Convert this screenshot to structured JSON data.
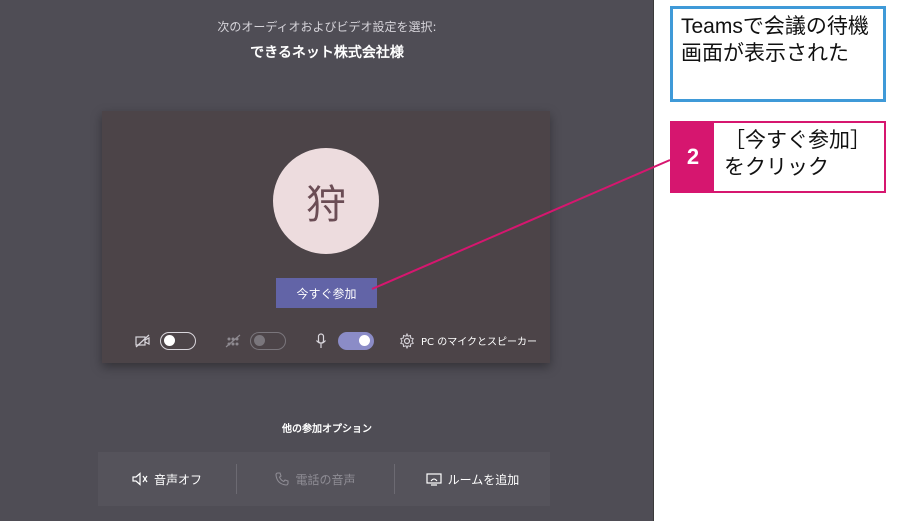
{
  "header": {
    "subtitle": "次のオーディオおよびビデオ設定を選択:",
    "meeting_name": "できるネット株式会社様"
  },
  "preview": {
    "avatar_initial": "狩",
    "join_label": "今すぐ参加",
    "controls": {
      "camera": {
        "icon": "camera-off-icon",
        "state": "off"
      },
      "background_blur": {
        "icon": "background-blur-icon",
        "state": "disabled"
      },
      "microphone": {
        "icon": "microphone-icon",
        "state": "on"
      },
      "device_settings_label": "PC のマイクとスピーカー",
      "device_settings_icon": "gear-icon"
    }
  },
  "other_options": {
    "heading": "他の参加オプション",
    "items": [
      {
        "label": "音声オフ",
        "icon": "speaker-off-icon",
        "enabled": true
      },
      {
        "label": "電話の音声",
        "icon": "phone-icon",
        "enabled": false
      },
      {
        "label": "ルームを追加",
        "icon": "room-icon",
        "enabled": true
      }
    ]
  },
  "annotations": {
    "caption": "Teamsで会議の待機画面が表示された",
    "step_number": "2",
    "step_text": "［今すぐ参加］をクリック"
  },
  "colors": {
    "window_bg": "#4f4d55",
    "card_bg": "#4c4448",
    "accent": "#6264a7",
    "avatar_bg": "#eddcde",
    "annotation_blue": "#3f9ad8",
    "annotation_magenta": "#d6166f"
  }
}
